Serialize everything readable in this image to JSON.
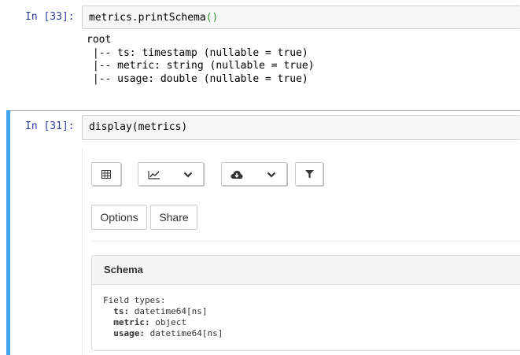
{
  "cell1": {
    "prompt": "In [33]:",
    "code_object": "metrics.printSchema",
    "code_parens": "()",
    "output": [
      "root",
      " |-- ts: timestamp (nullable = true)",
      " |-- metric: string (nullable = true)",
      " |-- usage: double (nullable = true)"
    ]
  },
  "cell2": {
    "prompt": "In [31]:",
    "code": "display(metrics)",
    "toolbar": {
      "table_icon": "table-icon",
      "chart_icon": "line-chart-icon",
      "download_icon": "cloud-download-icon",
      "filter_icon": "filter-icon",
      "dropdown_icon": "chevron-down-icon"
    },
    "buttons": {
      "options": "Options",
      "share": "Share"
    },
    "schema": {
      "title": "Schema",
      "heading": "Field types:",
      "fields": [
        {
          "name": "ts:",
          "type": "datetime64[ns]"
        },
        {
          "name": "metric:",
          "type": "object"
        },
        {
          "name": "usage:",
          "type": "datetime64[ns]"
        }
      ]
    }
  },
  "colors": {
    "prompt": "#303f9f",
    "selected_bar": "#42a5f5",
    "paren": "#2ea02e"
  }
}
